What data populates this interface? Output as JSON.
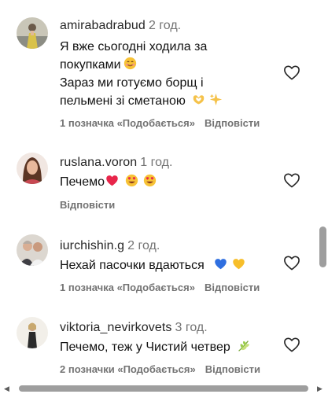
{
  "comments": [
    {
      "username": "amirabadrabud",
      "time": "2 год.",
      "lines": [
        "Я вже сьогодні ходила за",
        "покупками",
        "Зараз ми готуємо борщ і",
        "пельмені зі сметаною"
      ],
      "line_emojis": [
        "",
        "smiling-face-emoji",
        "",
        "heart-hands-and-sparkles-emoji"
      ],
      "likes_label": "1 позначка «Подобається»",
      "reply_label": "Відповісти",
      "like_icon": "heart-outline-icon"
    },
    {
      "username": "ruslana.voron",
      "time": "1 год.",
      "lines": [
        "Печемо"
      ],
      "line_emojis": [
        "red-heart-and-heart-eyes-emoji"
      ],
      "likes_label": "",
      "reply_label": "Відповісти",
      "like_icon": "heart-outline-icon"
    },
    {
      "username": "iurchishin.g",
      "time": "2 год.",
      "lines": [
        "Нехай пасочки вдаються"
      ],
      "line_emojis": [
        "blue-and-yellow-hearts-emoji"
      ],
      "likes_label": "1 позначка «Подобається»",
      "reply_label": "Відповісти",
      "like_icon": "heart-outline-icon"
    },
    {
      "username": "viktoria_nevirkovets",
      "time": "3 год.",
      "lines": [
        "Печемо, теж у Чистий четвер"
      ],
      "line_emojis": [
        "herb-emoji"
      ],
      "likes_label": "2 позначки «Подобається»",
      "reply_label": "Відповісти",
      "like_icon": "heart-outline-icon"
    }
  ],
  "colors": {
    "username": "#262626",
    "secondary_text": "#737373",
    "scrollbar_thumb": "#9e9e9e"
  }
}
